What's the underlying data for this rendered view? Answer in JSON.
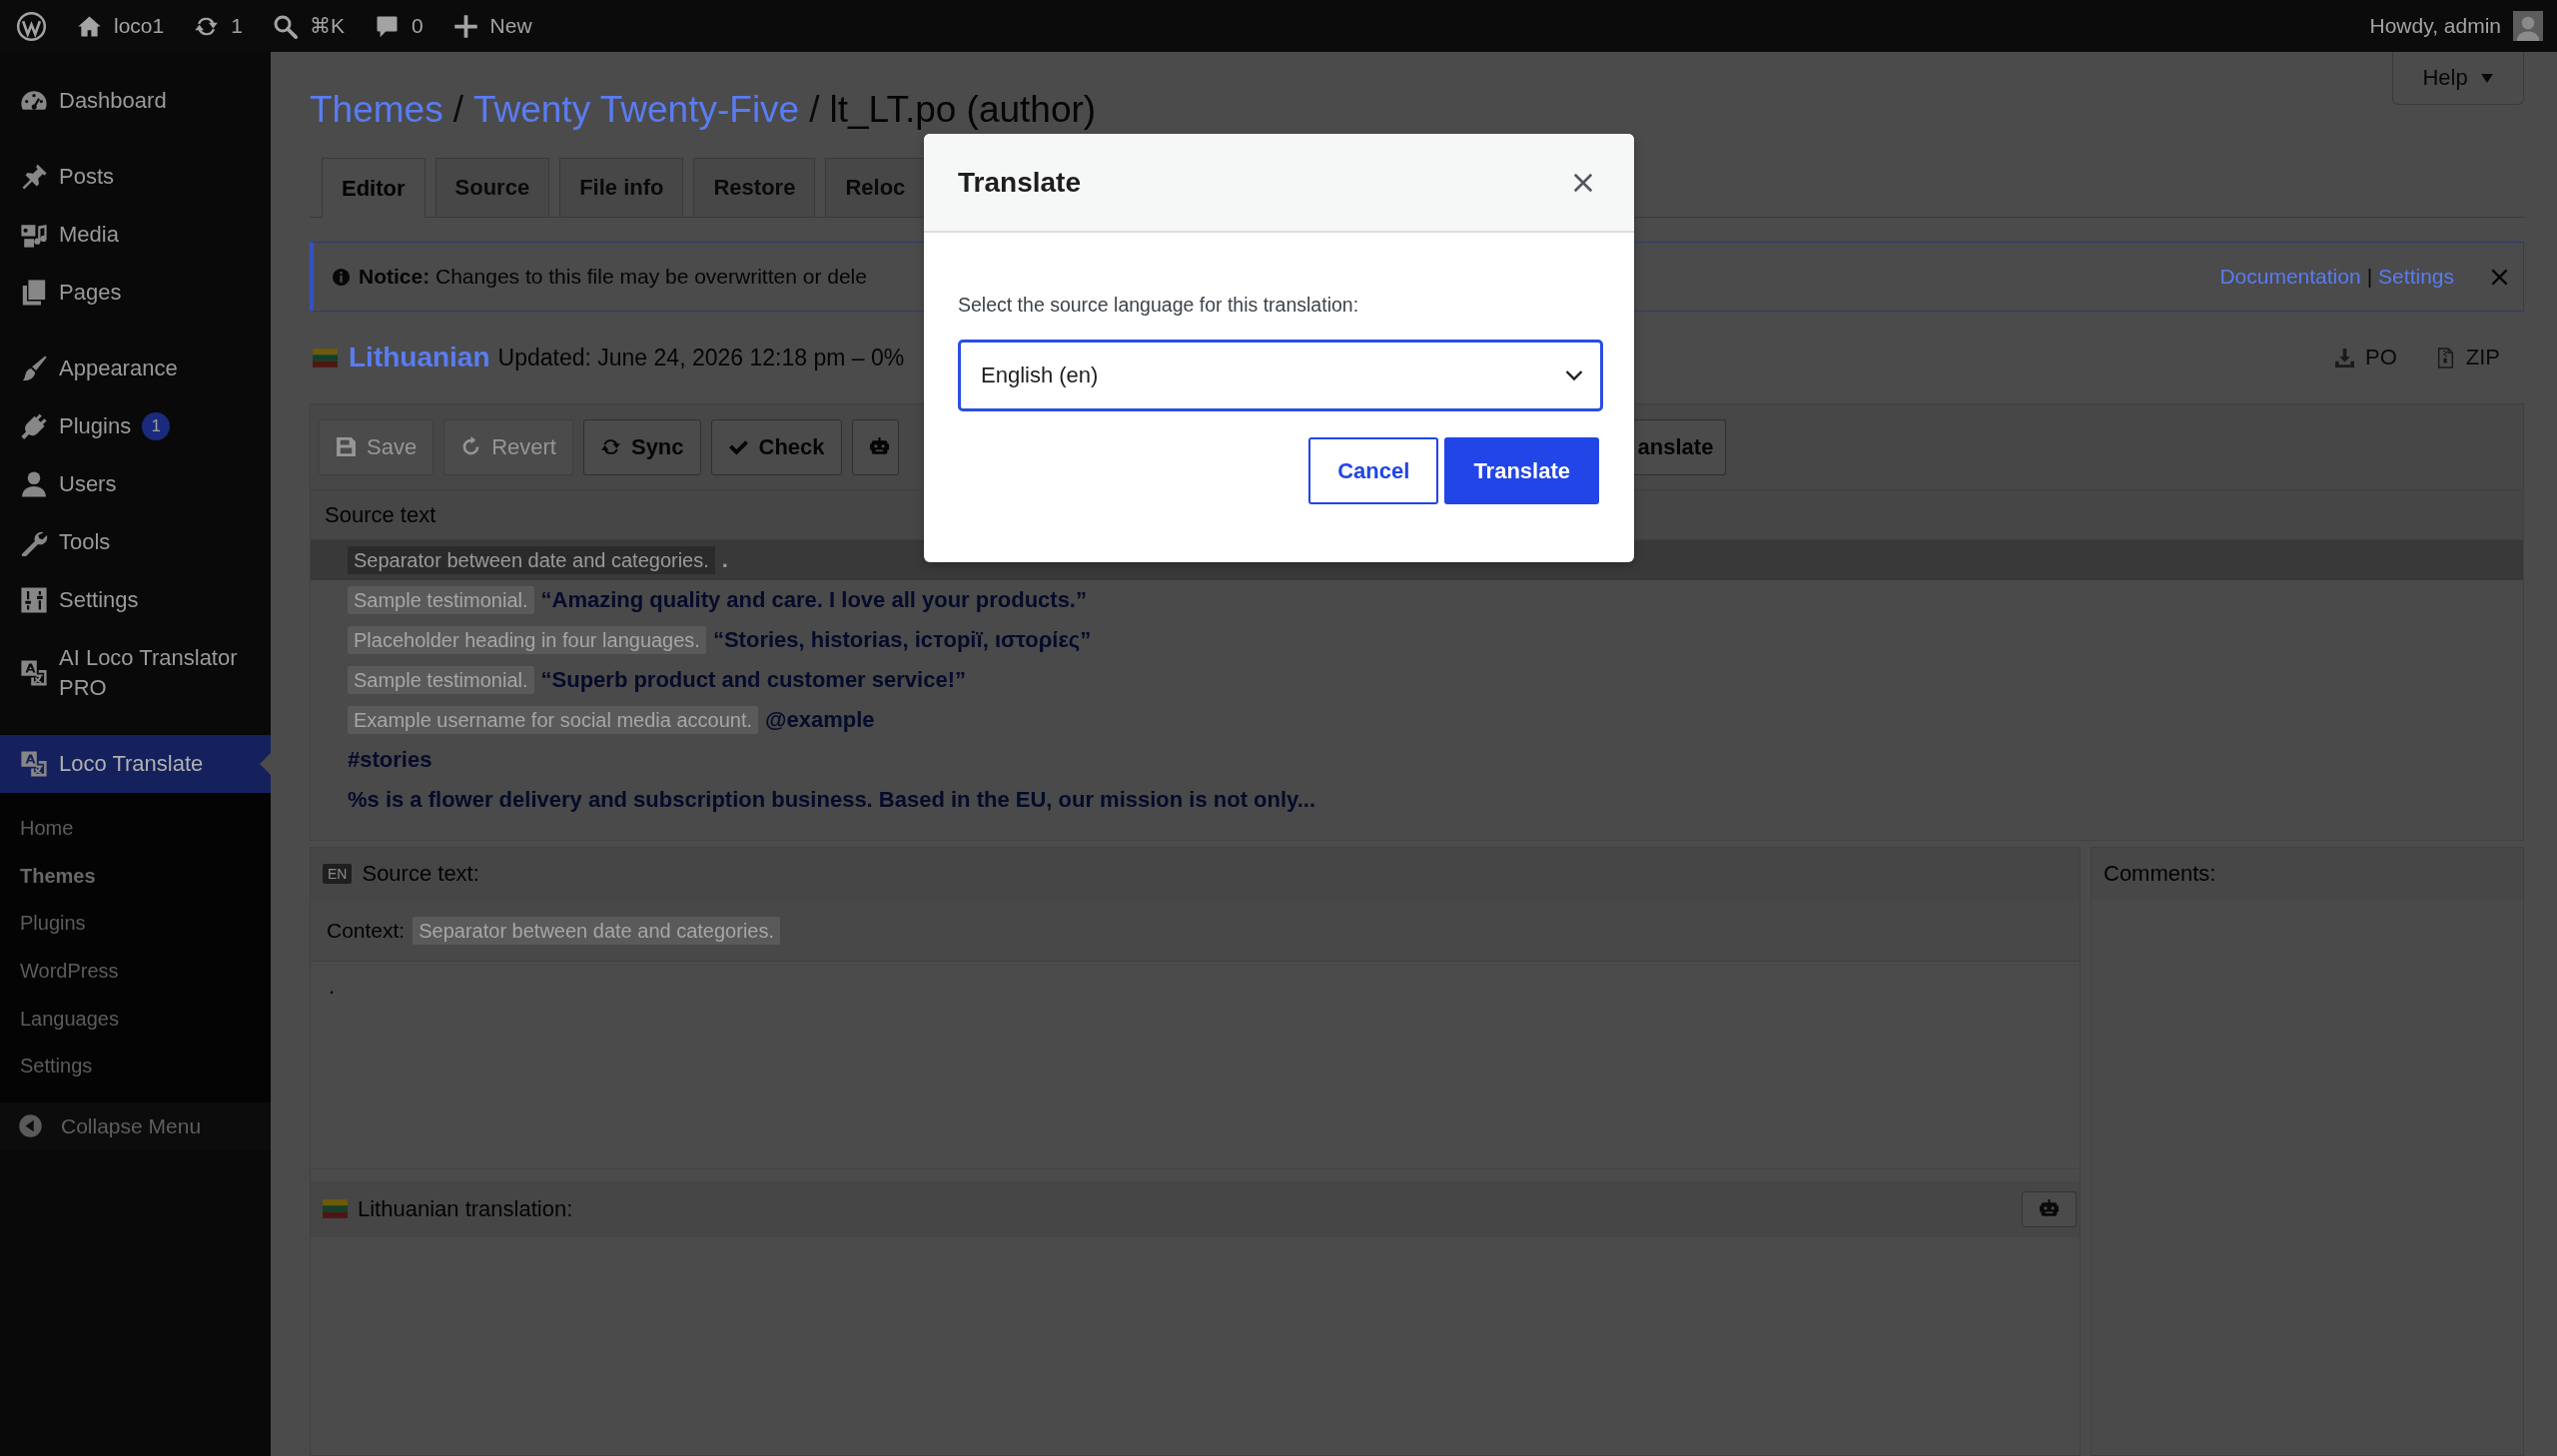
{
  "admin_bar": {
    "items": [
      {
        "kind": "logo"
      },
      {
        "kind": "site",
        "label": "loco1"
      },
      {
        "kind": "updates",
        "label": "1"
      },
      {
        "kind": "search",
        "label": "⌘K"
      },
      {
        "kind": "comments",
        "label": "0"
      },
      {
        "kind": "new",
        "label": "New"
      }
    ],
    "greeting": "Howdy, admin"
  },
  "sidebar": {
    "groups": [
      {
        "items": [
          {
            "label": "Dashboard",
            "selected": false
          }
        ]
      },
      {
        "items": [
          {
            "label": "Posts",
            "selected": false
          },
          {
            "label": "Media",
            "selected": false
          },
          {
            "label": "Pages",
            "selected": false
          }
        ]
      },
      {
        "items": [
          {
            "label": "Appearance",
            "selected": false
          },
          {
            "label": "Plugins",
            "selected": false,
            "badge": "1"
          },
          {
            "label": "Users",
            "selected": false
          },
          {
            "label": "Tools",
            "selected": false
          },
          {
            "label": "Settings",
            "selected": false
          },
          {
            "label": "AI Loco Translator PRO",
            "selected": false
          }
        ]
      },
      {
        "items": [
          {
            "label": "Loco Translate",
            "selected": true,
            "children": [
              {
                "label": "Home",
                "selected": false
              },
              {
                "label": "Themes",
                "selected": true
              },
              {
                "label": "Plugins",
                "selected": false
              },
              {
                "label": "WordPress",
                "selected": false
              },
              {
                "label": "Languages",
                "selected": false
              },
              {
                "label": "Settings",
                "selected": false
              }
            ]
          }
        ]
      }
    ],
    "collapse": "Collapse Menu"
  },
  "help": "Help",
  "breadcrumb": {
    "separator": "/",
    "items": [
      {
        "kind": "link",
        "label": "Themes"
      },
      {
        "kind": "link",
        "label": "Twenty Twenty-Five"
      },
      {
        "kind": "current",
        "label": "lt_LT.po (author)"
      }
    ]
  },
  "tabs": [
    {
      "label": "Editor",
      "selected": true
    },
    {
      "label": "Source",
      "selected": false
    },
    {
      "label": "File info",
      "selected": false
    },
    {
      "label": "Restore",
      "selected": false
    },
    {
      "label": "Reloc",
      "selected": false
    }
  ],
  "notice": {
    "text": "**Notice:** Changes to this file may be overwritten or dele",
    "links": [
      "Documentation",
      "Settings"
    ],
    "separator": "|"
  },
  "file_status": {
    "language": "Lithuanian",
    "updated": "Updated: June 24, 2026 12:18 pm – 0%"
  },
  "downloads": [
    {
      "kind": "download",
      "label": "PO"
    },
    {
      "kind": "archive",
      "label": "ZIP"
    }
  ],
  "toolbar": [
    {
      "kind": "save",
      "label": "Save",
      "disabled": true
    },
    {
      "kind": "revert",
      "label": "Revert",
      "disabled": true
    },
    {
      "kind": "sync",
      "label": "Sync",
      "disabled": false
    },
    {
      "kind": "check",
      "label": "Check",
      "disabled": false
    },
    {
      "kind": "robot",
      "disabled": false
    },
    {
      "kind": "plain",
      "label": "anslate",
      "disabled": false
    }
  ],
  "source_list": {
    "header": "Source text",
    "rows": [
      {
        "context": "Separator between date and categories.",
        "text": ".",
        "selected": true
      },
      {
        "context": "Sample testimonial.",
        "text": "“Amazing quality and care. I love all your products.”",
        "selected": false
      },
      {
        "context": "Placeholder heading in four languages.",
        "text": "“Stories, historias, історії, ιστορίες”",
        "selected": false
      },
      {
        "context": "Sample testimonial.",
        "text": "“Superb product and customer service!”",
        "selected": false
      },
      {
        "context": "Example username for social media account.",
        "text": "@example",
        "selected": false
      },
      {
        "text": "#stories",
        "selected": false
      },
      {
        "text": "%s is a flower delivery and subscription business. Based in the EU, our mission is not only...",
        "selected": false
      }
    ]
  },
  "editor": {
    "badge": "EN",
    "source_label": "Source text:",
    "context_label": "Context:",
    "context": "Separator between date and categories.",
    "source_text": ".",
    "translation_label": "Lithuanian translation:"
  },
  "comments": {
    "label": "Comments:"
  },
  "dialog": {
    "title": "Translate",
    "prompt": "Select the source language for this translation:",
    "language": "English (en)",
    "buttons": [
      {
        "kind": "secondary",
        "label": "Cancel"
      },
      {
        "kind": "primary",
        "label": "Translate"
      }
    ]
  }
}
